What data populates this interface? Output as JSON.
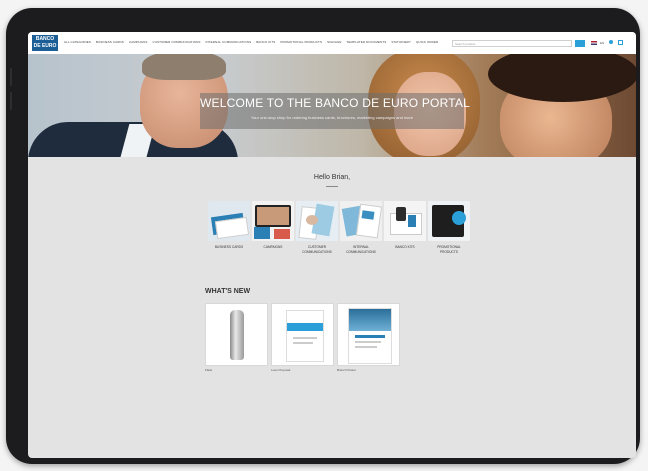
{
  "header": {
    "logo_line1": "BANCO",
    "logo_line2": "DE EURO",
    "nav": [
      "All Categories",
      "Business Cards",
      "Campaigns",
      "Customer Communications",
      "Internal Communications",
      "Banco Kits",
      "Promotional Products",
      "Signage",
      "Templated Documents",
      "Stationery",
      "Quick Order"
    ],
    "search_placeholder": "Search product",
    "language": "EN"
  },
  "hero": {
    "title": "WELCOME TO THE BANCO DE EURO PORTAL",
    "subtitle": "Your one-stop shop for ordering business cards, brochures, marketing campaigns and more"
  },
  "greeting": "Hello Brian,",
  "categories": [
    {
      "label": "Business Cards"
    },
    {
      "label": "Campaigns"
    },
    {
      "label": "Customer Communications"
    },
    {
      "label": "Internal Communications"
    },
    {
      "label": "Banco Kits"
    },
    {
      "label": "Promotional Products"
    }
  ],
  "whats_new": {
    "title": "WHAT'S NEW",
    "items": [
      {
        "label": "Flask"
      },
      {
        "label": "Loan Proposal"
      },
      {
        "label": "Branch Poster"
      }
    ]
  },
  "colors": {
    "brand": "#1c5f96",
    "accent": "#2a9fd8"
  }
}
